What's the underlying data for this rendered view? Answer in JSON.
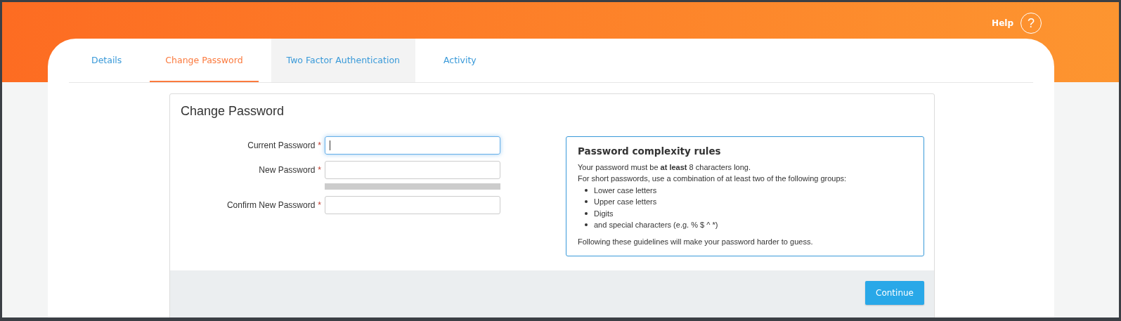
{
  "header": {
    "help_label": "Help",
    "help_icon": "?"
  },
  "tabs": [
    {
      "label": "Details",
      "selected": false,
      "hovered": false
    },
    {
      "label": "Change Password",
      "selected": true,
      "hovered": false
    },
    {
      "label": "Two Factor Authentication",
      "selected": false,
      "hovered": true
    },
    {
      "label": "Activity",
      "selected": false,
      "hovered": false
    }
  ],
  "panel": {
    "title": "Change Password",
    "fields": [
      {
        "label": "Current Password",
        "required_mark": "*",
        "focused": true
      },
      {
        "label": "New Password",
        "required_mark": "*",
        "focused": false,
        "strength": {
          "level": 0
        }
      },
      {
        "label": "Confirm New Password",
        "required_mark": "*",
        "focused": false
      }
    ],
    "rules": {
      "title": "Password complexity rules",
      "lines": [
        "Your password must be **at least** 8 characters long.",
        "For short passwords, use a combination of at least two of the following groups:"
      ],
      "items": [
        "Lower case letters",
        "Upper case letters",
        "Digits",
        "and special characters (e.g. % $ ^ *)"
      ],
      "footer": "Following these guidelines will make your password harder to guess."
    },
    "button": "Continue"
  }
}
